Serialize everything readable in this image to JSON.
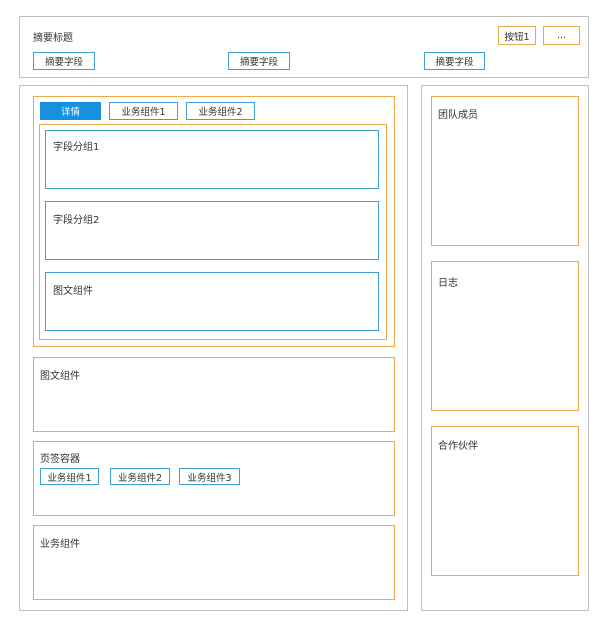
{
  "header": {
    "title": "摘要标题",
    "button1_label": "按钮1",
    "more_label": "...",
    "summary_fields": [
      "摘要字段",
      "摘要字段",
      "摘要字段"
    ]
  },
  "main": {
    "tabs": [
      {
        "label": "详情",
        "active": true
      },
      {
        "label": "业务组件1",
        "active": false
      },
      {
        "label": "业务组件2",
        "active": false
      }
    ],
    "field_groups": [
      "字段分组1",
      "字段分组2"
    ],
    "image_text_inner": "图文组件",
    "image_text": "图文组件",
    "tab_container": {
      "title": "页签容器",
      "buttons": [
        "业务组件1",
        "业务组件2",
        "业务组件3"
      ]
    },
    "business_component": "业务组件"
  },
  "sidebar": {
    "team_members": "团队成员",
    "log": "日志",
    "partners": "合作伙伴"
  },
  "colors": {
    "accent": "#1890e0",
    "outline_blue": "#3fa0d8",
    "outline_orange": "#f0a94a",
    "outline_gray": "#bfbfbf"
  }
}
